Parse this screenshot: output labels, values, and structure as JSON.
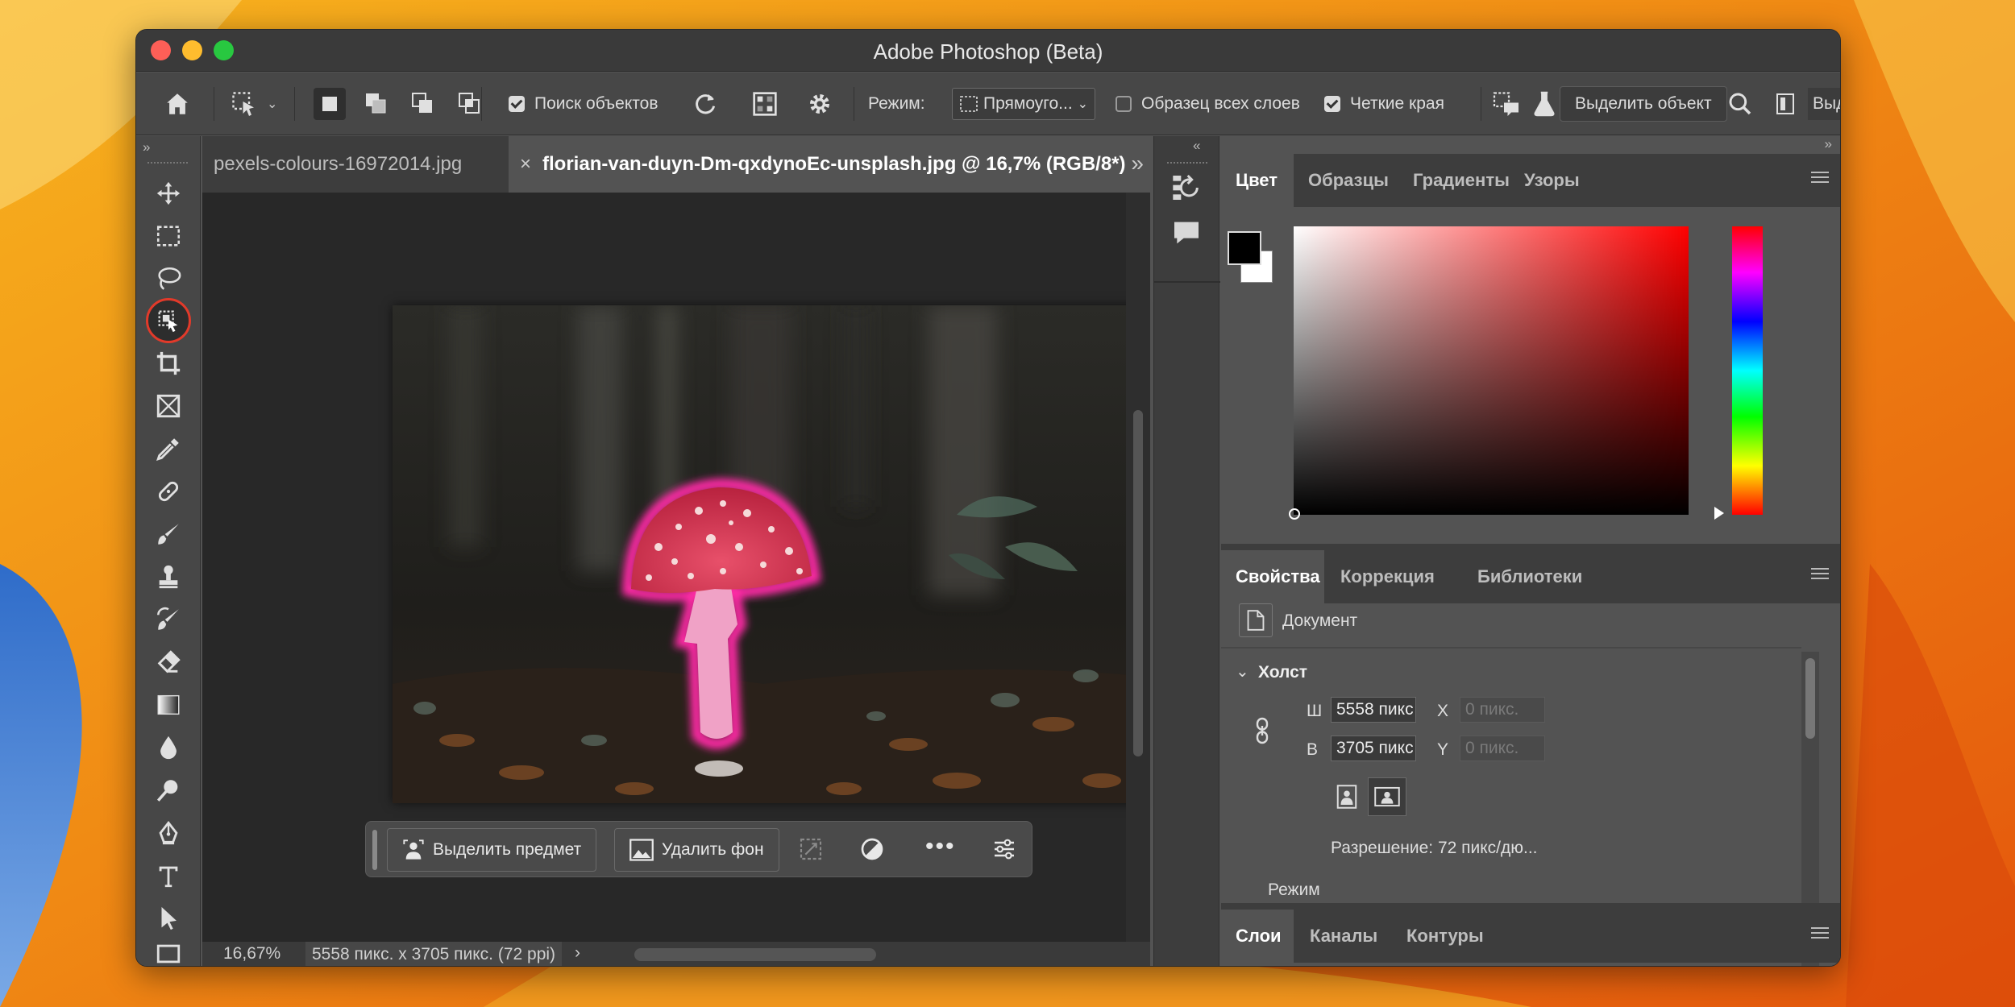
{
  "window": {
    "title": "Adobe Photoshop (Beta)"
  },
  "options_bar": {
    "object_finder_label": "Поиск объектов",
    "mode_label": "Режим:",
    "mode_value": "Прямоуго...",
    "sample_all_layers_label": "Образец всех слоев",
    "hard_edge_label": "Четкие края",
    "select_object_button": "Выделить объект",
    "overflow_text": "Выд"
  },
  "documents": {
    "tabs": [
      {
        "label": "pexels-colours-16972014.jpg",
        "active": false
      },
      {
        "label": "florian-van-duyn-Dm-qxdynoEc-unsplash.jpg @ 16,7% (RGB/8*)",
        "active": true
      }
    ]
  },
  "context_bar": {
    "select_subject": "Выделить предмет",
    "remove_background": "Удалить фон"
  },
  "status": {
    "zoom": "16,67%",
    "doc_info": "5558 пикс. x 3705 пикс. (72 ppi)"
  },
  "color_panel": {
    "tabs": [
      "Цвет",
      "Образцы",
      "Градиенты",
      "Узоры"
    ],
    "active_tab": "Цвет",
    "hue_color": "#ff0000",
    "foreground": "#000000",
    "background": "#ffffff"
  },
  "properties_panel": {
    "tabs": [
      "Свойства",
      "Коррекция",
      "Библиотеки"
    ],
    "doc_label": "Документ",
    "canvas_section": "Холст",
    "width_label": "Ш",
    "width_value": "5558 пикс",
    "x_label": "X",
    "x_placeholder": "0 пикс.",
    "height_label": "В",
    "height_value": "3705 пикс",
    "y_label": "Y",
    "y_placeholder": "0 пикс.",
    "resolution": "Разрешение: 72 пикс/дю...",
    "mode_label": "Режим"
  },
  "layers_panel": {
    "tabs": [
      "Слои",
      "Каналы",
      "Контуры"
    ]
  }
}
